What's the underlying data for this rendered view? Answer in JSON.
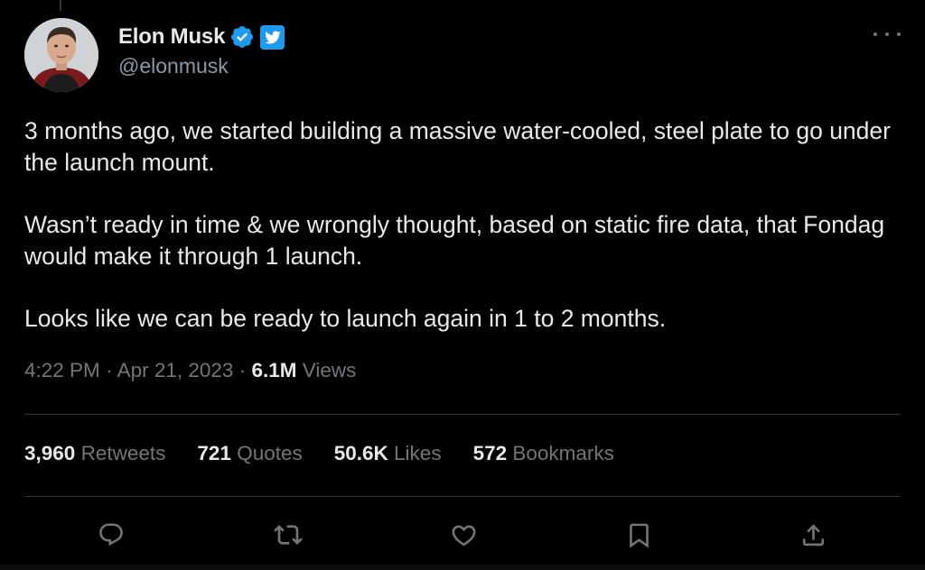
{
  "author": {
    "name": "Elon Musk",
    "handle": "@elonmusk"
  },
  "tweet": {
    "paragraphs": [
      "3 months ago, we started building a massive water-cooled, steel plate to go under the launch mount.",
      "Wasn’t ready in time & we wrongly thought, based on static fire data, that Fondag would make it through 1 launch.",
      "Looks like we can be ready to launch again in 1 to 2 months."
    ],
    "time": "4:22 PM",
    "separator": "·",
    "date": "Apr 21, 2023",
    "views_count": "6.1M",
    "views_label": "Views"
  },
  "stats": {
    "retweets": {
      "count": "3,960",
      "label": "Retweets"
    },
    "quotes": {
      "count": "721",
      "label": "Quotes"
    },
    "likes": {
      "count": "50.6K",
      "label": "Likes"
    },
    "bookmarks": {
      "count": "572",
      "label": "Bookmarks"
    }
  },
  "icons": {
    "verified": "verified-badge-icon",
    "affiliate": "twitter-bird-icon",
    "more": "more-icon",
    "reply": "reply-icon",
    "retweet": "retweet-icon",
    "like": "heart-icon",
    "bookmark": "bookmark-icon",
    "share": "share-icon"
  },
  "colors": {
    "background": "#000000",
    "text": "#e7e9ea",
    "secondary_text": "#71767b",
    "accent": "#1d9bf0",
    "divider": "#2f3336"
  }
}
